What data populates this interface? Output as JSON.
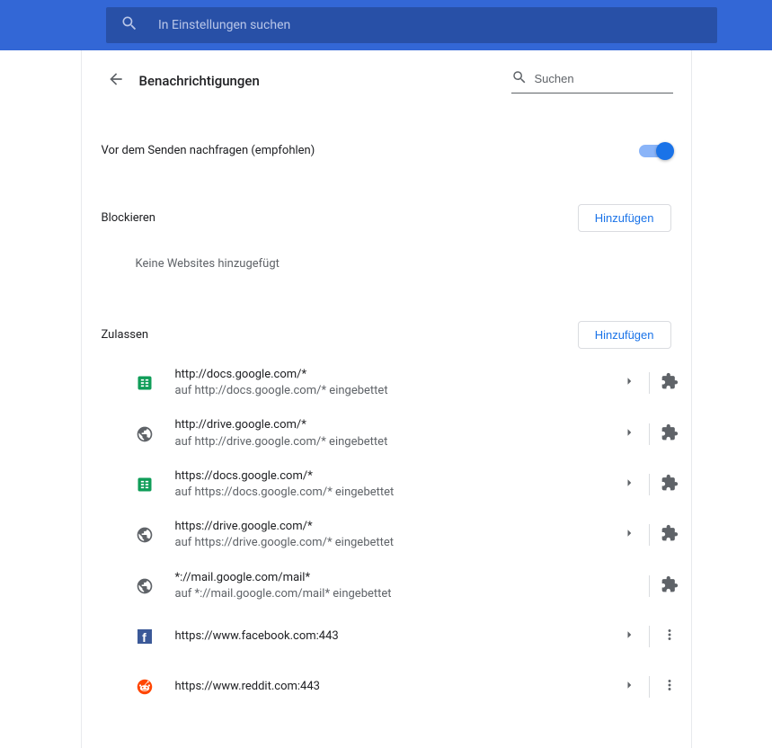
{
  "topbar": {
    "search_placeholder": "In Einstellungen suchen"
  },
  "header": {
    "title": "Benachrichtigungen",
    "local_search_placeholder": "Suchen"
  },
  "toggle": {
    "label": "Vor dem Senden nachfragen (empfohlen)"
  },
  "block": {
    "title": "Blockieren",
    "add_label": "Hinzufügen",
    "empty": "Keine Websites hinzugefügt"
  },
  "allow": {
    "title": "Zulassen",
    "add_label": "Hinzufügen",
    "items": [
      {
        "icon": "sheets",
        "url": "http://docs.google.com/*",
        "sub": "auf http://docs.google.com/* eingebettet",
        "expand": true,
        "trailing": "extension"
      },
      {
        "icon": "globe",
        "url": "http://drive.google.com/*",
        "sub": "auf http://drive.google.com/* eingebettet",
        "expand": true,
        "trailing": "extension"
      },
      {
        "icon": "sheets",
        "url": "https://docs.google.com/*",
        "sub": "auf https://docs.google.com/* eingebettet",
        "expand": true,
        "trailing": "extension"
      },
      {
        "icon": "globe",
        "url": "https://drive.google.com/*",
        "sub": "auf https://drive.google.com/* eingebettet",
        "expand": true,
        "trailing": "extension"
      },
      {
        "icon": "globe",
        "url": "*://mail.google.com/mail*",
        "sub": "auf *://mail.google.com/mail* eingebettet",
        "expand": false,
        "trailing": "extension"
      },
      {
        "icon": "facebook",
        "url": "https://www.facebook.com:443",
        "sub": "",
        "expand": true,
        "trailing": "menu"
      },
      {
        "icon": "reddit",
        "url": "https://www.reddit.com:443",
        "sub": "",
        "expand": true,
        "trailing": "menu"
      }
    ]
  }
}
